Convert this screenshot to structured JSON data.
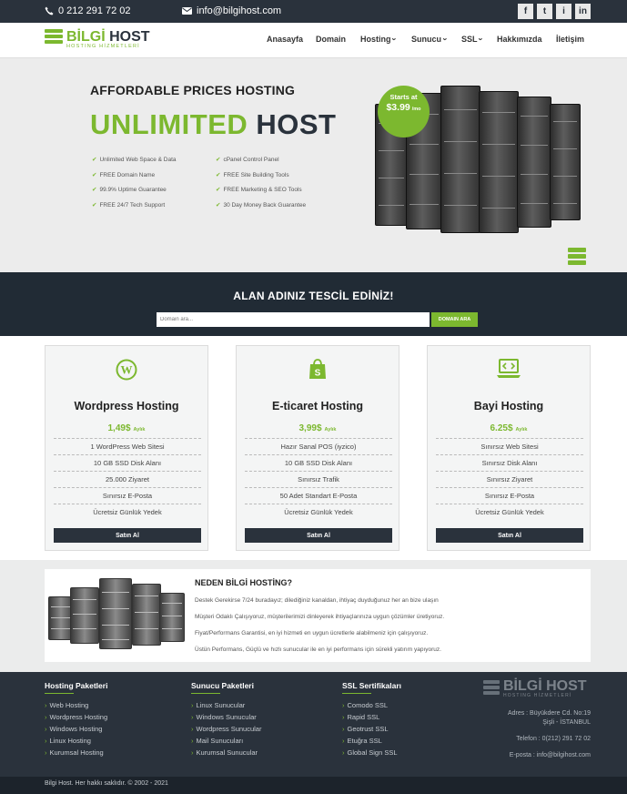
{
  "topbar": {
    "phone": "0 212 291 72 02",
    "email": "info@bilgihost.com",
    "social": [
      "f",
      "t",
      "i",
      "in"
    ]
  },
  "brand": {
    "name_a": "BİLGİ",
    "name_b": " HOST",
    "tagline": "HOSTING HİZMETLERİ"
  },
  "nav": {
    "items": [
      "Anasayfa",
      "Domain",
      "Hosting",
      "Sunucu",
      "SSL",
      "Hakkımızda",
      "İletişim"
    ],
    "dropdown_icon": "chevron-down-icon"
  },
  "hero": {
    "subtitle": "AFFORDABLE PRICES HOSTING",
    "title_a": "UNLIMITED",
    "title_b": " HOST",
    "features": [
      "Unlimited Web Space & Data",
      "cPanel Control Panel",
      "FREE Domain Name",
      "FREE Site Building Tools",
      "99.9% Uptime Guarantee",
      "FREE Marketing & SEO Tools",
      "FREE 24/7 Tech Support",
      "30 Day Money Back Guarantee"
    ],
    "badge_line1": "Starts at",
    "badge_price": "$3.99",
    "badge_unit": "/mo"
  },
  "domain": {
    "title": "ALAN ADINIZ TESCİL EDİNİZ!",
    "placeholder": "Domain ara...",
    "button": "DOMAIN ARA"
  },
  "packages": [
    {
      "icon": "wordpress-icon",
      "name": "Wordpress Hosting",
      "price": "1,49$",
      "period": "Aylık",
      "features": [
        "1 WordPress Web Sitesi",
        "10 GB SSD Disk Alanı",
        "25.000 Ziyaret",
        "Sınırsız E-Posta",
        "Ücretsiz Günlük Yedek"
      ],
      "button": "Satın Al"
    },
    {
      "icon": "shopify-bag-icon",
      "name": "E-ticaret Hosting",
      "price": "3,99$",
      "period": "Aylık",
      "features": [
        "Hazır Sanal POS (iyzico)",
        "10 GB SSD Disk Alanı",
        "Sınırsız Trafik",
        "50 Adet Standart E-Posta",
        "Ücretsiz Günlük Yedek"
      ],
      "button": "Satın Al"
    },
    {
      "icon": "laptop-code-icon",
      "name": "Bayi Hosting",
      "price": "6.25$",
      "period": "Aylık",
      "features": [
        "Sınırsız Web Sitesi",
        "Sınırsız Disk Alanı",
        "Sınırsız Ziyaret",
        "Sınırsız E-Posta",
        "Ücretsiz Günlük Yedek"
      ],
      "button": "Satın Al"
    }
  ],
  "why": {
    "title": "NEDEN BİLGİ HOSTİNG?",
    "paragraphs": [
      "Destek Gerekirse 7/24 buradayız; dilediğiniz kanaldan, ihtiyaç duyduğunuz her an bize ulaşın",
      "Müşteri Odaklı Çalışıyoruz, müşterilerimizi dinleyerek ihtiyaçlarınıza uygun çözümler üretiyoruz.",
      "Fiyat/Performans Garantisi, en iyi hizmeti en uygun ücretlerle alabilmeniz için çalışıyoruz.",
      "Üstün Performans, Güçlü ve hızlı sunucular ile en iyi performans için sürekli yatırım yapıyoruz."
    ]
  },
  "footer": {
    "columns": [
      {
        "title": "Hosting Paketleri",
        "items": [
          "Web Hosting",
          "Wordpress Hosting",
          "Windows Hosting",
          "Linux Hosting",
          "Kurumsal Hosting"
        ]
      },
      {
        "title": "Sunucu Paketleri",
        "items": [
          "Linux Sunucular",
          "Windows Sunucular",
          "Wordpress Sunucular",
          "Mail Sunucuları",
          "Kurumsal Sunucular"
        ]
      },
      {
        "title": "SSL Sertifikaları",
        "items": [
          "Comodo SSL",
          "Rapid SSL",
          "Geotrust SSL",
          "Etuğra SSL",
          "Global Sign SSL"
        ]
      }
    ],
    "address1": "Adres : Büyükdere Cd. No:19",
    "address2": "Şişli - İSTANBUL",
    "phone": "Telefon : 0(212) 291 72 02",
    "email": "E-posta : info@bilgihost.com",
    "copyright": "Bilgi Host. Her hakkı saklıdır. © 2002 - 2021"
  },
  "colors": {
    "accent": "#7cb82f",
    "dark": "#2a323c",
    "domain_bg": "#212b35"
  }
}
